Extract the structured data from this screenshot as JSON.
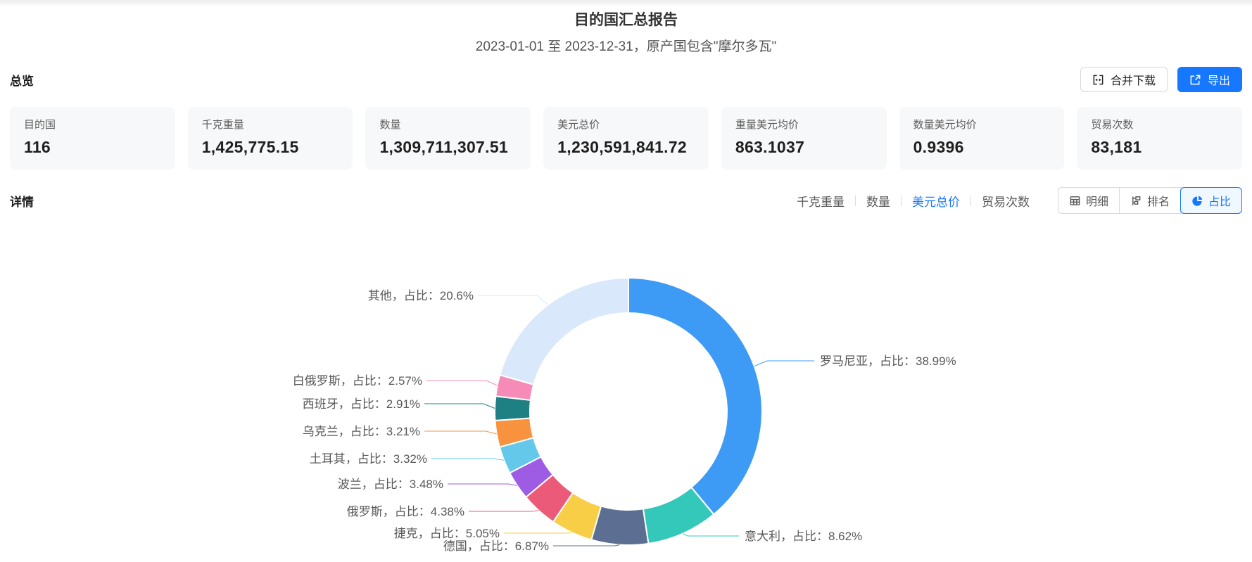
{
  "header": {
    "title": "目的国汇总报告",
    "subtitle": "2023-01-01 至 2023-12-31，原产国包含\"摩尔多瓦\""
  },
  "toolbar": {
    "merge_download_label": "合并下载",
    "export_label": "导出",
    "export_color": "#1677ff"
  },
  "overview": {
    "section_title": "总览",
    "cards": [
      {
        "label": "目的国",
        "value": "116"
      },
      {
        "label": "千克重量",
        "value": "1,425,775.15"
      },
      {
        "label": "数量",
        "value": "1,309,711,307.51"
      },
      {
        "label": "美元总价",
        "value": "1,230,591,841.72"
      },
      {
        "label": "重量美元均价",
        "value": "863.1037"
      },
      {
        "label": "数量美元均价",
        "value": "0.9396"
      },
      {
        "label": "贸易次数",
        "value": "83,181"
      }
    ]
  },
  "detail": {
    "section_title": "详情",
    "metric_tabs": [
      {
        "label": "千克重量",
        "active": false
      },
      {
        "label": "数量",
        "active": false
      },
      {
        "label": "美元总价",
        "active": true
      },
      {
        "label": "贸易次数",
        "active": false
      }
    ],
    "view_buttons": [
      {
        "label": "明细",
        "icon": "table-icon",
        "active": false
      },
      {
        "label": "排名",
        "icon": "ranking-icon",
        "active": false
      },
      {
        "label": "占比",
        "icon": "pie-icon",
        "active": true
      }
    ],
    "active_color": "#1677ff"
  },
  "chart_data": {
    "type": "pie",
    "subtype": "donut",
    "start_angle": "top",
    "direction": "clockwise",
    "legend": "none",
    "label_format": "{name}，占比：{percent}%",
    "slices": [
      {
        "name": "罗马尼亚",
        "percent": 38.99,
        "color": "#3E9BF5"
      },
      {
        "name": "意大利",
        "percent": 8.62,
        "color": "#33C8B9"
      },
      {
        "name": "德国",
        "percent": 6.87,
        "color": "#5C6E91"
      },
      {
        "name": "捷克",
        "percent": 5.05,
        "color": "#F7CE46"
      },
      {
        "name": "俄罗斯",
        "percent": 4.38,
        "color": "#EB5A78"
      },
      {
        "name": "波兰",
        "percent": 3.48,
        "color": "#9D5CE3"
      },
      {
        "name": "土耳其",
        "percent": 3.32,
        "color": "#63C8E9"
      },
      {
        "name": "乌克兰",
        "percent": 3.21,
        "color": "#F9923F"
      },
      {
        "name": "西班牙",
        "percent": 2.91,
        "color": "#1F8084"
      },
      {
        "name": "白俄罗斯",
        "percent": 2.57,
        "color": "#F78BB8"
      },
      {
        "name": "其他",
        "percent": 20.6,
        "color": "#D9E8FB"
      }
    ]
  }
}
